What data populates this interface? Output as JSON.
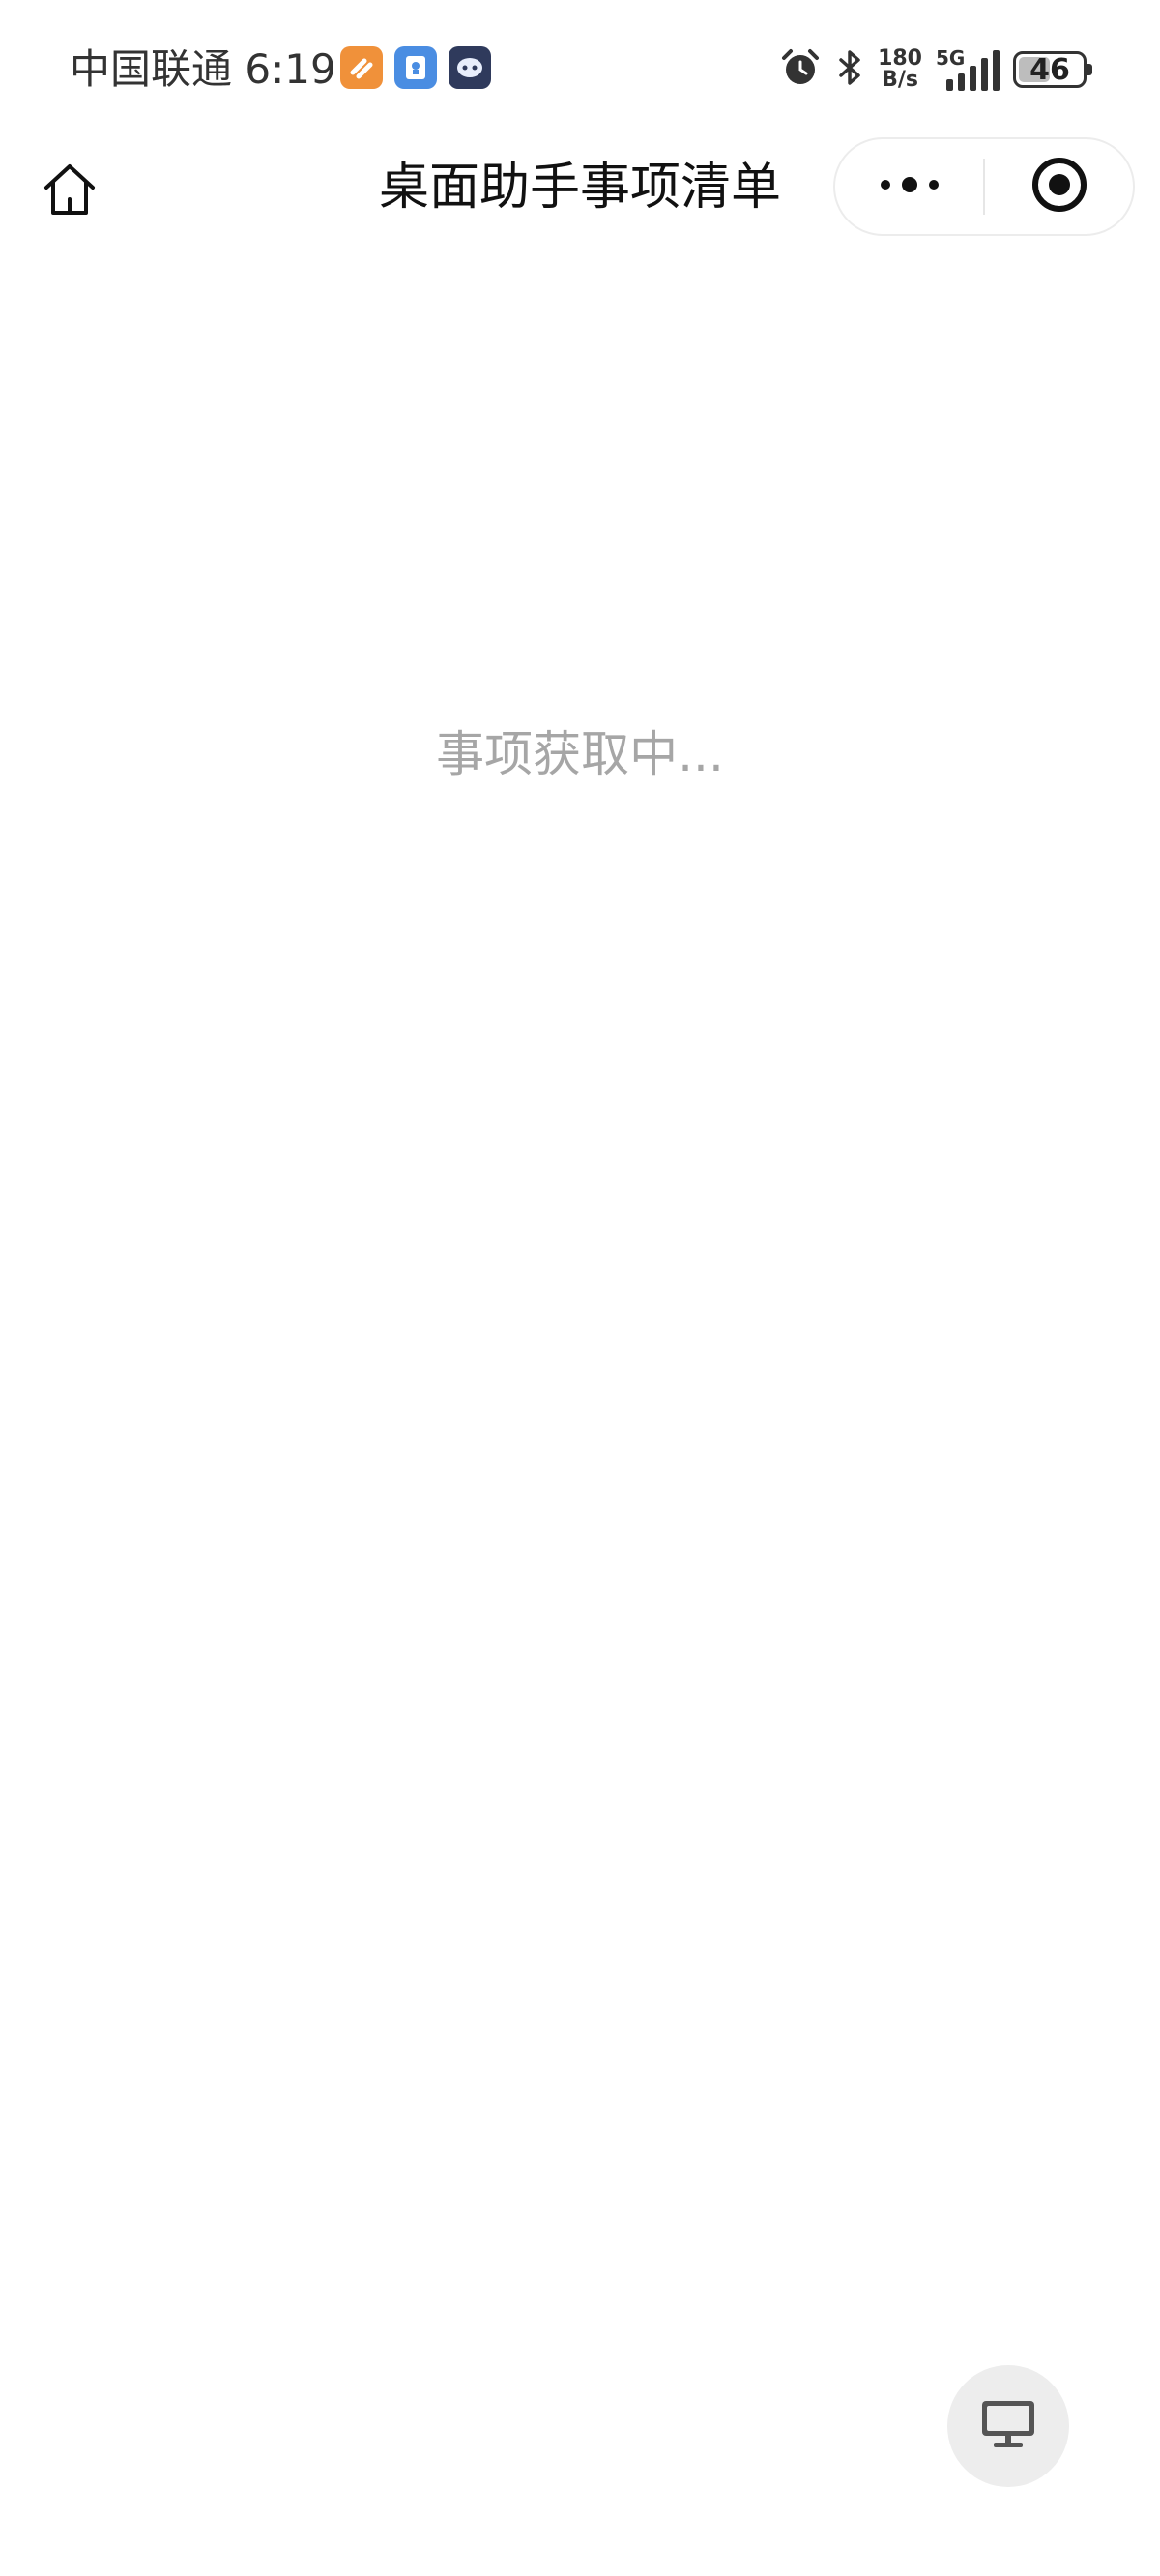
{
  "status_bar": {
    "carrier_time": "中国联通 6:19",
    "notification_icons": [
      {
        "name": "orange-app-icon",
        "color": "#f0913a"
      },
      {
        "name": "blue-app-icon",
        "color": "#4a8de2"
      },
      {
        "name": "chat-bot-app-icon",
        "color": "#2f3a5c"
      }
    ],
    "net_speed_value": "180",
    "net_speed_unit": "B/s",
    "network_type": "5G",
    "battery_level": "46"
  },
  "nav_bar": {
    "home_icon": "home-icon",
    "title": "桌面助手事项清单",
    "more_icon": "more-dots-icon",
    "close_icon": "target-circle-icon"
  },
  "main": {
    "loading_text": "事项获取中..."
  },
  "float_button": {
    "icon": "desktop-monitor-icon"
  }
}
